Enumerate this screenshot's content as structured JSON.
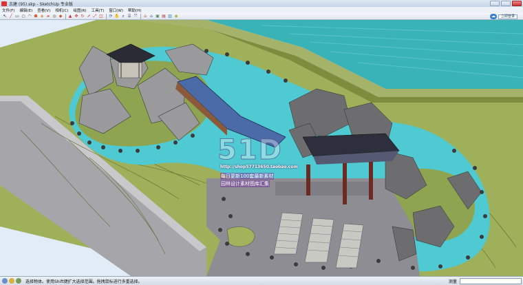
{
  "window": {
    "title": "古建 (95).skp - SketchUp 专业版"
  },
  "menu": {
    "items": [
      "文件(F)",
      "编辑(E)",
      "查看(V)",
      "相机(C)",
      "绘图(R)",
      "工具(T)",
      "窗口(W)",
      "帮助(H)"
    ]
  },
  "toolbar": {
    "login_label": "立即登录"
  },
  "status": {
    "hint": "选择物体。使用Shift键扩大选择范围。拖拽鼠标进行多重选择。",
    "measure_label": "测量"
  },
  "watermark": {
    "logo": "51D",
    "url": "http://shop57713650.taobao.com",
    "caption_1": "每日更新100套最新素材",
    "caption_2": "园林设计素材图库汇集"
  },
  "colors": {
    "sky": "#d9e8f7",
    "water": "#4fc9d2",
    "grass": "#9fb05a",
    "paving": "#8d8d93",
    "river": "#3ab3b7"
  }
}
